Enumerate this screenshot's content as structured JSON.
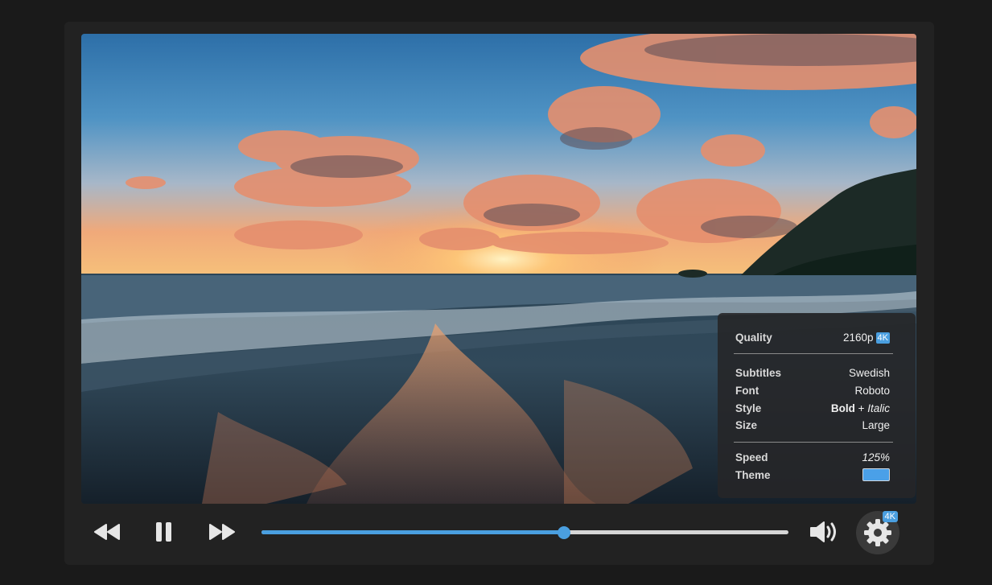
{
  "settings": {
    "quality_label": "Quality",
    "quality_value": "2160p",
    "quality_badge": "4K",
    "subtitles_label": "Subtitles",
    "subtitles_value": "Swedish",
    "font_label": "Font",
    "font_value": "Roboto",
    "style_label": "Style",
    "style_bold": "Bold",
    "style_plus": " + ",
    "style_italic": "Italic",
    "size_label": "Size",
    "size_value": "Large",
    "speed_label": "Speed",
    "speed_value": "125%",
    "theme_label": "Theme",
    "theme_color": "#4aa0e8"
  },
  "controls": {
    "progress": 0.574,
    "accent_color": "#4a9fe0",
    "settings_badge": "4K",
    "icons": [
      "rewind-icon",
      "pause-icon",
      "fast-forward-icon",
      "volume-icon",
      "gear-icon"
    ]
  }
}
